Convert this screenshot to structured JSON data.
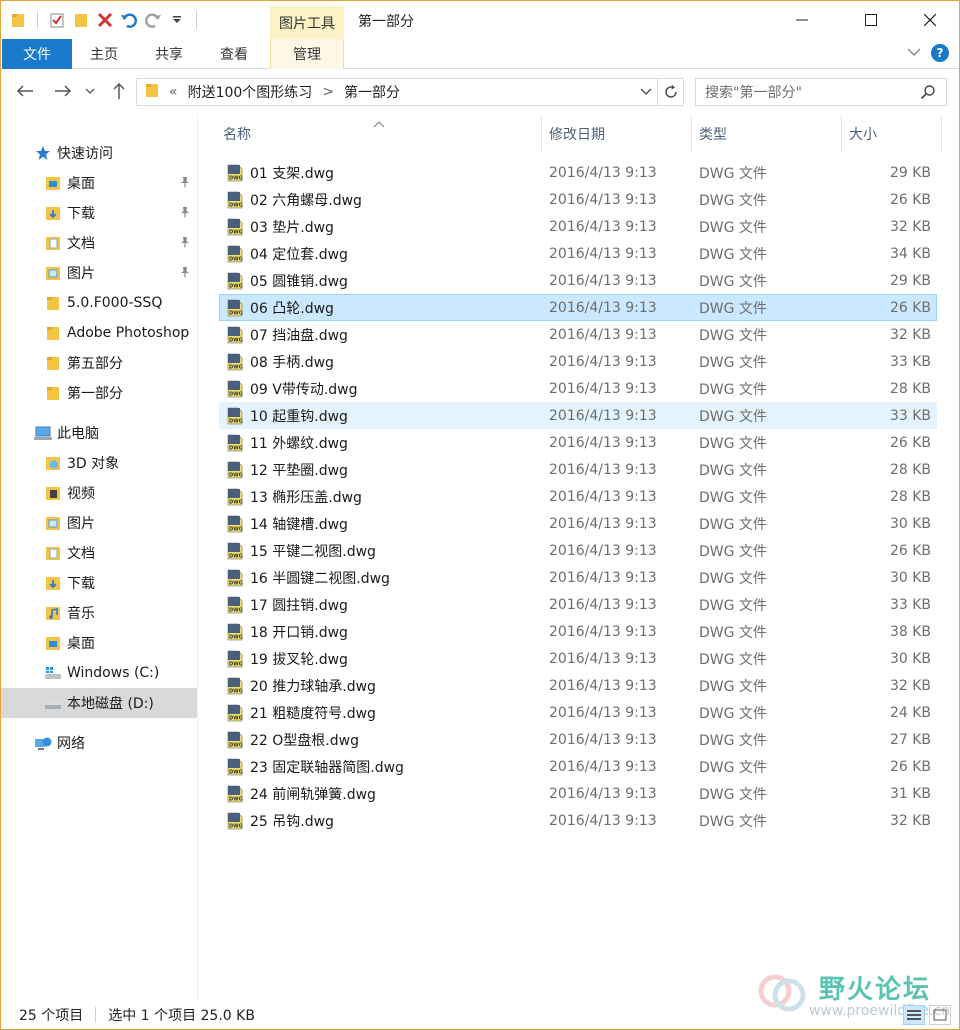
{
  "title_bar": {
    "tools_tab": "图片工具",
    "window_title": "第一部分"
  },
  "ribbon": {
    "tabs": [
      "文件",
      "主页",
      "共享",
      "查看",
      "管理"
    ]
  },
  "address_bar": {
    "overflow": "«",
    "crumbs": [
      "附送100个图形练习",
      "第一部分"
    ],
    "separator": ">"
  },
  "search": {
    "placeholder": "搜索\"第一部分\""
  },
  "sidebar": {
    "items": [
      {
        "label": "快速访问",
        "icon": "star-icon",
        "level": 0,
        "pinned": false
      },
      {
        "label": "桌面",
        "icon": "desktop-folder-icon",
        "level": 1,
        "pinned": true
      },
      {
        "label": "下载",
        "icon": "downloads-folder-icon",
        "level": 1,
        "pinned": true
      },
      {
        "label": "文档",
        "icon": "documents-folder-icon",
        "level": 1,
        "pinned": true
      },
      {
        "label": "图片",
        "icon": "pictures-folder-icon",
        "level": 1,
        "pinned": true
      },
      {
        "label": "5.0.F000-SSQ",
        "icon": "folder-icon",
        "level": 1,
        "pinned": false
      },
      {
        "label": "Adobe Photoshop",
        "icon": "folder-icon",
        "level": 1,
        "pinned": false
      },
      {
        "label": "第五部分",
        "icon": "folder-icon",
        "level": 1,
        "pinned": false
      },
      {
        "label": "第一部分",
        "icon": "folder-icon",
        "level": 1,
        "pinned": false
      },
      {
        "label": "此电脑",
        "icon": "computer-icon",
        "level": 0,
        "pinned": false
      },
      {
        "label": "3D 对象",
        "icon": "3d-objects-icon",
        "level": 1,
        "pinned": false
      },
      {
        "label": "视频",
        "icon": "videos-folder-icon",
        "level": 1,
        "pinned": false
      },
      {
        "label": "图片",
        "icon": "pictures-folder-icon",
        "level": 1,
        "pinned": false
      },
      {
        "label": "文档",
        "icon": "documents-folder-icon",
        "level": 1,
        "pinned": false
      },
      {
        "label": "下载",
        "icon": "downloads-folder-icon",
        "level": 1,
        "pinned": false
      },
      {
        "label": "音乐",
        "icon": "music-folder-icon",
        "level": 1,
        "pinned": false
      },
      {
        "label": "桌面",
        "icon": "desktop-folder-icon",
        "level": 1,
        "pinned": false
      },
      {
        "label": "Windows (C:)",
        "icon": "windows-drive-icon",
        "level": 1,
        "pinned": false
      },
      {
        "label": "本地磁盘 (D:)",
        "icon": "drive-icon",
        "level": 1,
        "pinned": false,
        "active": true
      },
      {
        "label": "网络",
        "icon": "network-icon",
        "level": 0,
        "pinned": false
      }
    ]
  },
  "file_list": {
    "columns": [
      "名称",
      "修改日期",
      "类型",
      "大小"
    ],
    "selected_index": 5,
    "hover_index": 9,
    "files": [
      {
        "name": "01 支架.dwg",
        "date": "2016/4/13 9:13",
        "type": "DWG 文件",
        "size": "29 KB"
      },
      {
        "name": "02 六角螺母.dwg",
        "date": "2016/4/13 9:13",
        "type": "DWG 文件",
        "size": "26 KB"
      },
      {
        "name": "03 垫片.dwg",
        "date": "2016/4/13 9:13",
        "type": "DWG 文件",
        "size": "32 KB"
      },
      {
        "name": "04 定位套.dwg",
        "date": "2016/4/13 9:13",
        "type": "DWG 文件",
        "size": "34 KB"
      },
      {
        "name": "05 圆锥销.dwg",
        "date": "2016/4/13 9:13",
        "type": "DWG 文件",
        "size": "29 KB"
      },
      {
        "name": "06 凸轮.dwg",
        "date": "2016/4/13 9:13",
        "type": "DWG 文件",
        "size": "26 KB"
      },
      {
        "name": "07 挡油盘.dwg",
        "date": "2016/4/13 9:13",
        "type": "DWG 文件",
        "size": "32 KB"
      },
      {
        "name": "08 手柄.dwg",
        "date": "2016/4/13 9:13",
        "type": "DWG 文件",
        "size": "33 KB"
      },
      {
        "name": "09 V带传动.dwg",
        "date": "2016/4/13 9:13",
        "type": "DWG 文件",
        "size": "28 KB"
      },
      {
        "name": "10 起重钩.dwg",
        "date": "2016/4/13 9:13",
        "type": "DWG 文件",
        "size": "33 KB"
      },
      {
        "name": "11 外螺纹.dwg",
        "date": "2016/4/13 9:13",
        "type": "DWG 文件",
        "size": "26 KB"
      },
      {
        "name": "12 平垫圈.dwg",
        "date": "2016/4/13 9:13",
        "type": "DWG 文件",
        "size": "28 KB"
      },
      {
        "name": "13 椭形压盖.dwg",
        "date": "2016/4/13 9:13",
        "type": "DWG 文件",
        "size": "28 KB"
      },
      {
        "name": "14 轴键槽.dwg",
        "date": "2016/4/13 9:13",
        "type": "DWG 文件",
        "size": "30 KB"
      },
      {
        "name": "15 平键二视图.dwg",
        "date": "2016/4/13 9:13",
        "type": "DWG 文件",
        "size": "26 KB"
      },
      {
        "name": "16 半圆键二视图.dwg",
        "date": "2016/4/13 9:13",
        "type": "DWG 文件",
        "size": "30 KB"
      },
      {
        "name": "17 圆拄销.dwg",
        "date": "2016/4/13 9:13",
        "type": "DWG 文件",
        "size": "33 KB"
      },
      {
        "name": "18 开口销.dwg",
        "date": "2016/4/13 9:13",
        "type": "DWG 文件",
        "size": "38 KB"
      },
      {
        "name": "19 拔叉轮.dwg",
        "date": "2016/4/13 9:13",
        "type": "DWG 文件",
        "size": "30 KB"
      },
      {
        "name": "20 推力球轴承.dwg",
        "date": "2016/4/13 9:13",
        "type": "DWG 文件",
        "size": "32 KB"
      },
      {
        "name": "21 粗糙度符号.dwg",
        "date": "2016/4/13 9:13",
        "type": "DWG 文件",
        "size": "24 KB"
      },
      {
        "name": "22 O型盘根.dwg",
        "date": "2016/4/13 9:13",
        "type": "DWG 文件",
        "size": "27 KB"
      },
      {
        "name": "23 固定联轴器简图.dwg",
        "date": "2016/4/13 9:13",
        "type": "DWG 文件",
        "size": "26 KB"
      },
      {
        "name": "24 前闸轨弹簧.dwg",
        "date": "2016/4/13 9:13",
        "type": "DWG 文件",
        "size": "31 KB"
      },
      {
        "name": "25 吊钩.dwg",
        "date": "2016/4/13 9:13",
        "type": "DWG 文件",
        "size": "32 KB"
      }
    ],
    "file_icon": "dwg-file-icon"
  },
  "status_bar": {
    "item_count": "25 个项目",
    "selection": "选中 1 个项目  25.0 KB"
  },
  "watermark": {
    "brand": "野火论坛",
    "url": "www.proewildfire.cn"
  },
  "colors": {
    "accent": "#1979ca",
    "selected_bg": "#cce8ff",
    "selected_border": "#99d1ff",
    "hover_bg": "#e5f3ff",
    "tools_tab_bg": "#fdf2c6",
    "window_border": "#e8a33a",
    "folder_yellow": "#f4c542"
  }
}
